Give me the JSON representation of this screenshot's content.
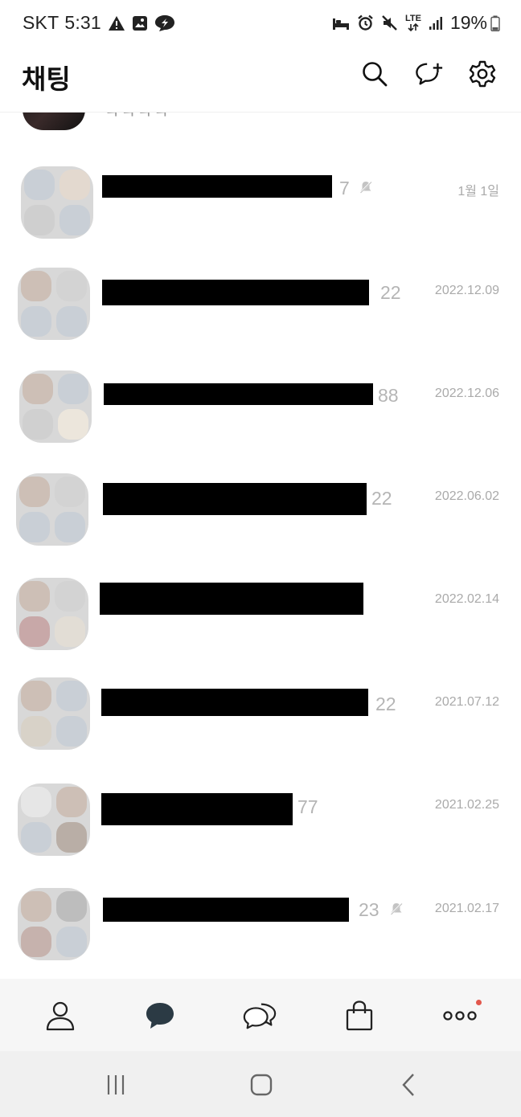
{
  "status_bar": {
    "carrier": "SKT",
    "time": "5:31",
    "network": "LTE",
    "battery": "19%"
  },
  "header": {
    "title": "채팅"
  },
  "partial_row": {
    "preview": "ㅋㅋㅋㅋ"
  },
  "chats": [
    {
      "count": "7",
      "muted": true,
      "date": "1월 1일"
    },
    {
      "count": "22",
      "muted": false,
      "date": "2022.12.09"
    },
    {
      "count": "88",
      "muted": false,
      "date": "2022.12.06"
    },
    {
      "count": "22",
      "muted": false,
      "date": "2022.06.02"
    },
    {
      "count": "",
      "muted": false,
      "date": "2022.02.14"
    },
    {
      "count": "22",
      "muted": false,
      "date": "2021.07.12"
    },
    {
      "count": "77",
      "muted": false,
      "date": "2021.02.25"
    },
    {
      "count": "23",
      "muted": true,
      "date": "2021.02.17"
    }
  ],
  "bottom_nav": {
    "items": [
      "friends-icon",
      "chat-icon",
      "openchat-icon",
      "shopping-icon",
      "more-icon"
    ],
    "active": "chat-icon",
    "badge_color": "#e2574c"
  },
  "colors": {
    "accent": "#2b3a44",
    "muted_text": "#b5b5b5",
    "date_text": "#aaaaaa"
  }
}
